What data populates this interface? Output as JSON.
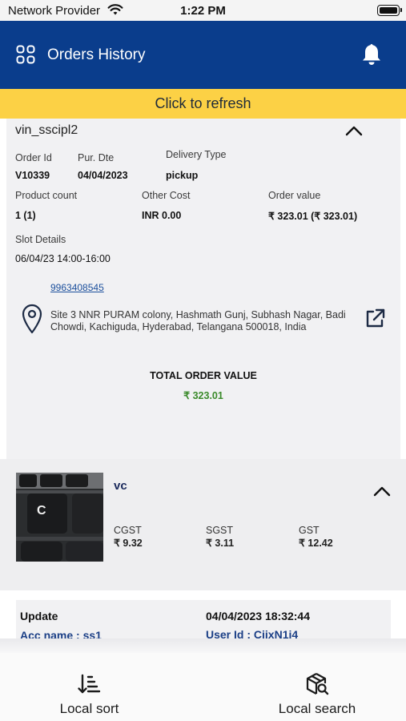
{
  "status_bar": {
    "carrier": "Network Provider",
    "time": "1:22 PM"
  },
  "header": {
    "title": "Orders History",
    "menu_icon": "grid-icon",
    "notification_icon": "bell-icon",
    "background_color": "#0a3d8c"
  },
  "refresh": {
    "label": "Click to refresh",
    "color": "#fcd145"
  },
  "order": {
    "store_name": "vin_sscipl2",
    "order_id_label": "Order Id",
    "order_id": "V10339",
    "purchase_date_label": "Pur. Dte",
    "purchase_date": "04/04/2023",
    "delivery_type_label": "Delivery Type",
    "delivery_type": "pickup",
    "product_count_label": "Product count",
    "product_count": "1 (1)",
    "other_cost_label": "Other Cost",
    "other_cost": "INR 0.00",
    "order_value_label": "Order value",
    "order_value": "₹ 323.01 (₹ 323.01)",
    "slot_label": "Slot Details",
    "slot_value": "06/04/23  14:00-16:00",
    "phone": "9963408545",
    "address": "Site 3 NNR PURAM colony, Hashmath Gunj, Subhash Nagar, Badi Chowdi, Kachiguda, Hyderabad, Telangana 500018, India",
    "total_label": "TOTAL ORDER VALUE",
    "total_value": "₹ 323.01"
  },
  "item": {
    "name": "vc",
    "thumb_key_letter": "C",
    "cgst_label": "CGST",
    "cgst_value": "₹ 9.32",
    "sgst_label": "SGST",
    "sgst_value": "₹ 3.11",
    "gst_label": "GST",
    "gst_value": "₹ 12.42"
  },
  "update": {
    "label": "Update",
    "datetime": "04/04/2023 18:32:44",
    "acc_name": "Acc name : ss1",
    "user_id": "User Id : CiixN1i4"
  },
  "bottom_nav": {
    "sort_label": "Local sort",
    "search_label": "Local search"
  }
}
